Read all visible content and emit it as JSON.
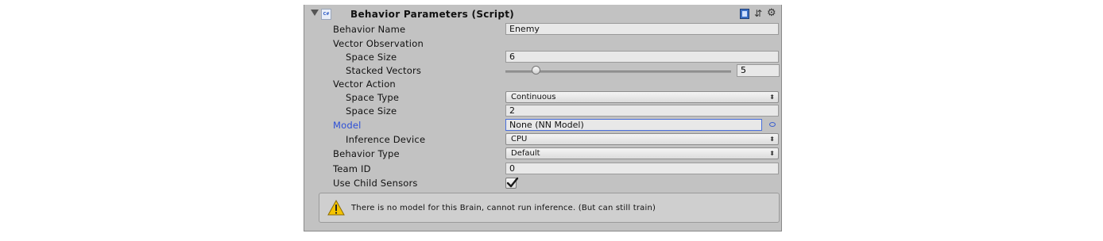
{
  "component": {
    "title": "Behavior Parameters (Script)",
    "script_icon_text": "C#"
  },
  "fields": {
    "behavior_name": {
      "label": "Behavior Name",
      "value": "Enemy"
    },
    "vector_observation": {
      "label": "Vector Observation"
    },
    "obs_space_size": {
      "label": "Space Size",
      "value": "6"
    },
    "stacked_vectors": {
      "label": "Stacked Vectors",
      "value": "5",
      "slider_fraction": 0.05
    },
    "vector_action": {
      "label": "Vector Action"
    },
    "space_type": {
      "label": "Space Type",
      "value": "Continuous"
    },
    "act_space_size": {
      "label": "Space Size",
      "value": "2"
    },
    "model": {
      "label": "Model",
      "value": "None (NN Model)"
    },
    "inference_device": {
      "label": "Inference Device",
      "value": "CPU"
    },
    "behavior_type": {
      "label": "Behavior Type",
      "value": "Default"
    },
    "team_id": {
      "label": "Team ID",
      "value": "0"
    },
    "use_child_sensors": {
      "label": "Use Child Sensors",
      "checked": true
    }
  },
  "help": {
    "message": "There is no model for this Brain, cannot run inference. (But can still train)"
  },
  "colors": {
    "panel_bg": "#c2c2c2",
    "highlight_label": "#2c4fd6",
    "warning_yellow": "#f5c400"
  },
  "icons": {
    "foldout": "triangle-down-icon",
    "help": "book-icon",
    "presets": "sliders-icon",
    "settings": "gear-icon",
    "object_picker": "target-icon",
    "warning": "warning-icon"
  }
}
